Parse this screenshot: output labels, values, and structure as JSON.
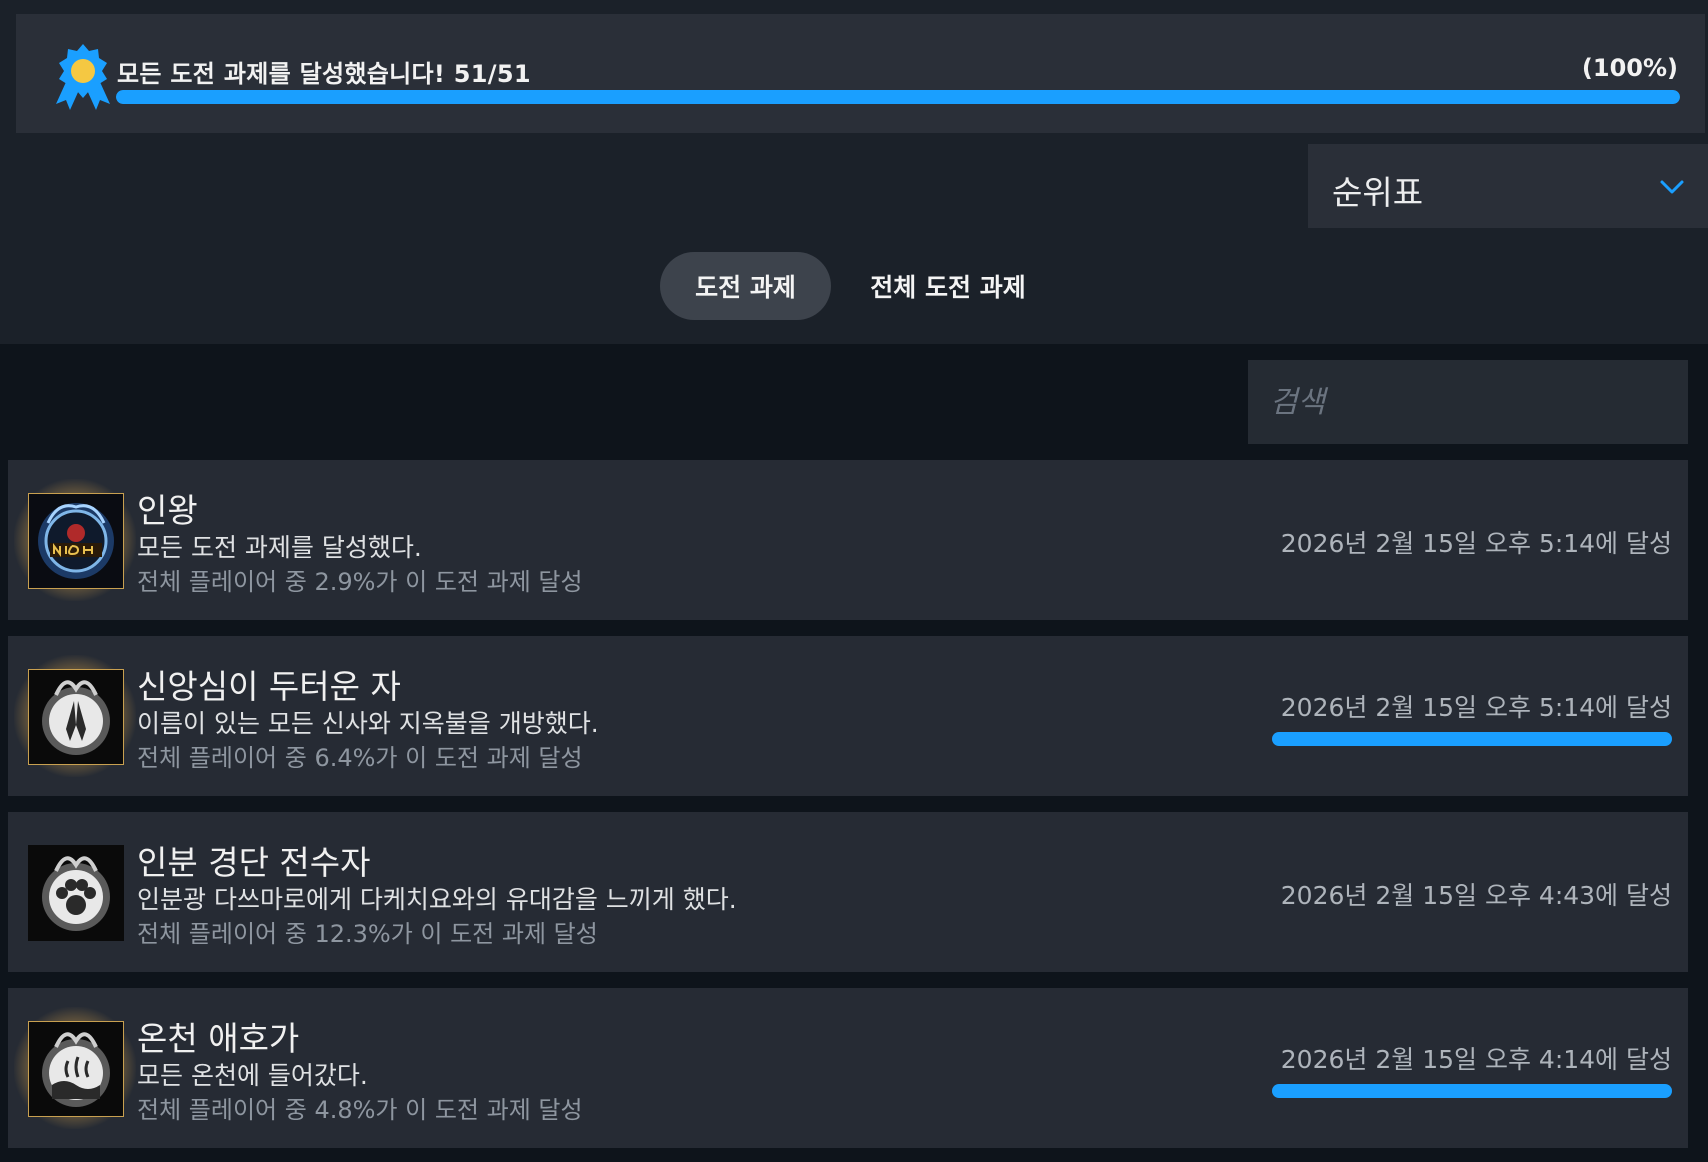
{
  "summary": {
    "icon": "award-ribbon-icon",
    "text": "모든 도전 과제를 달성했습니다! 51/51",
    "percent_label": "(100%)",
    "progress": 1.0,
    "accent_color": "#1a9fff"
  },
  "sort": {
    "selected": "순위표",
    "icon": "chevron-down-icon"
  },
  "tabs": [
    {
      "label": "도전 과제",
      "active": true
    },
    {
      "label": "전체 도전 과제",
      "active": false
    }
  ],
  "search": {
    "placeholder": "검색",
    "value": ""
  },
  "achievements": [
    {
      "icon": "nioh-emblem-icon",
      "title": "인왕",
      "description": "모든 도전 과제를 달성했다.",
      "global_percent": "전체 플레이어 중 2.9%가 이 도전 과제 달성",
      "unlocked": "2026년 2월 15일 오후 5:14에 달성",
      "show_bar": false,
      "rare": true
    },
    {
      "icon": "praying-hands-icon",
      "title": "신앙심이 두터운 자",
      "description": "이름이 있는 모든 신사와 지옥불을 개방했다.",
      "global_percent": "전체 플레이어 중 6.4%가 이 도전 과제 달성",
      "unlocked": "2026년 2월 15일 오후 5:14에 달성",
      "show_bar": true,
      "progress": 1.0,
      "rare": true
    },
    {
      "icon": "paw-print-icon",
      "title": "인분 경단 전수자",
      "description": "인분광 다쓰마로에게 다케치요와의 유대감을 느끼게 했다.",
      "global_percent": "전체 플레이어 중 12.3%가 이 도전 과제 달성",
      "unlocked": "2026년 2월 15일 오후 4:43에 달성",
      "show_bar": false,
      "rare": false
    },
    {
      "icon": "hot-spring-icon",
      "title": "온천 애호가",
      "description": "모든 온천에 들어갔다.",
      "global_percent": "전체 플레이어 중 4.8%가 이 도전 과제 달성",
      "unlocked": "2026년 2월 15일 오후 4:14에 달성",
      "show_bar": true,
      "progress": 1.0,
      "rare": true
    }
  ]
}
